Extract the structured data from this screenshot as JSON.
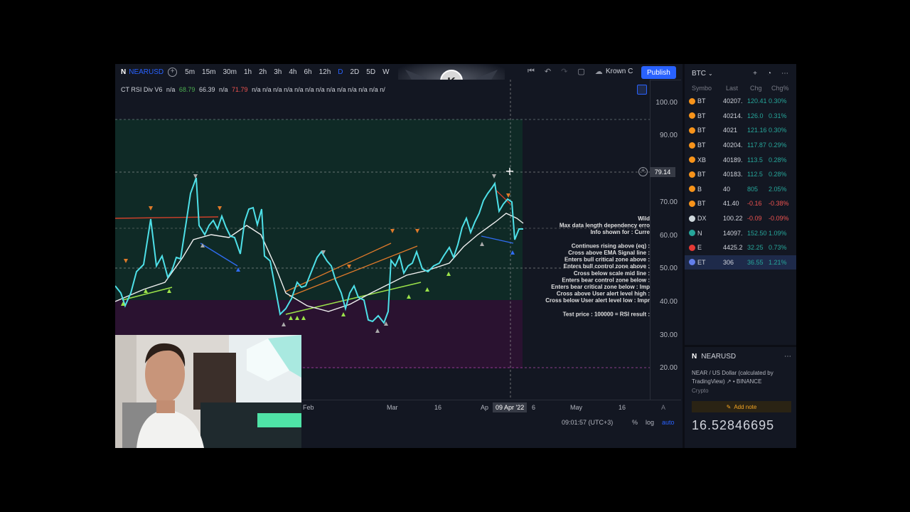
{
  "toolbar": {
    "symbol": "NEARUSD",
    "symbol_logo": "N",
    "intervals": [
      "5m",
      "15m",
      "30m",
      "1h",
      "2h",
      "3h",
      "4h",
      "6h",
      "12h",
      "D",
      "2D",
      "5D",
      "W"
    ],
    "active_interval": "D",
    "layout_name": "Krown C",
    "publish_label": "Publish"
  },
  "indicator": {
    "name": "CT RSI Div V6",
    "values": [
      "n/a",
      "68.79",
      "66.39",
      "n/a",
      "71.79",
      "n/a n/a n/a n/a n/a n/a n/a n/a n/a n/a n/a n/a n/"
    ]
  },
  "price_scale": {
    "ticks": [
      "100.00",
      "90.00",
      "79.14",
      "70.00",
      "60.00",
      "50.00",
      "40.00",
      "30.00",
      "20.00"
    ],
    "crosshair_value": "79.14"
  },
  "time_axis": {
    "ticks": [
      "Feb",
      "Mar",
      "16",
      "Ap",
      "6",
      "May",
      "16"
    ],
    "crosshair_date": "09 Apr '22"
  },
  "status": {
    "clock": "09:01:57 (UTC+3)",
    "percent": "%",
    "log": "log",
    "auto": "auto"
  },
  "annotation_lines": [
    "Wild",
    "Max data length dependency erro",
    "Info shown for : Curre",
    "",
    "Continues rising above (eq) :",
    "Cross above EMA Signal line :",
    "Enters bull critical zone above :",
    "Enters bull control zone above :",
    "Cross below scale mid line :",
    "Enters bear control zone below :",
    "Enters bear critical zone below : Imp",
    "Cross above  User alert level high :",
    "Cross below  User alert level low : Impr",
    "",
    "Test price : 100000 = RSI result :"
  ],
  "watchlist": {
    "name": "BTC",
    "columns": [
      "Symbo",
      "Last",
      "Chg",
      "Chg%"
    ],
    "rows": [
      {
        "sym": "BT",
        "last": "40207.",
        "chg": "120.41",
        "pct": "0.30%",
        "dir": "pos",
        "icon": "#f7931a"
      },
      {
        "sym": "BT",
        "last": "40214.",
        "chg": "126.0",
        "pct": "0.31%",
        "dir": "pos",
        "icon": "#f7931a"
      },
      {
        "sym": "BT",
        "last": "4021",
        "chg": "121.16",
        "pct": "0.30%",
        "dir": "pos",
        "icon": "#f7931a"
      },
      {
        "sym": "BT",
        "last": "40204.",
        "chg": "117.87",
        "pct": "0.29%",
        "dir": "pos",
        "icon": "#f7931a"
      },
      {
        "sym": "XB",
        "last": "40189.",
        "chg": "113.5",
        "pct": "0.28%",
        "dir": "pos",
        "icon": "#f7931a"
      },
      {
        "sym": "BT",
        "last": "40183.",
        "chg": "112.5",
        "pct": "0.28%",
        "dir": "pos",
        "icon": "#f7931a"
      },
      {
        "sym": "B",
        "last": "40",
        "chg": "805",
        "pct": "2.05%",
        "dir": "pos",
        "icon": "#f7931a"
      },
      {
        "sym": "BT",
        "last": "41.40",
        "chg": "-0.16",
        "pct": "-0.38%",
        "dir": "neg",
        "icon": "#f7931a"
      },
      {
        "sym": "DX",
        "last": "100.22",
        "chg": "-0.09",
        "pct": "-0.09%",
        "dir": "neg",
        "icon": "#cfd8dc"
      },
      {
        "sym": "N",
        "last": "14097.",
        "chg": "152.50",
        "pct": "1.09%",
        "dir": "pos",
        "icon": "#26a69a"
      },
      {
        "sym": "E",
        "last": "4425.2",
        "chg": "32.25",
        "pct": "0.73%",
        "dir": "pos",
        "icon": "#e53935"
      },
      {
        "sym": "ET",
        "last": "306",
        "chg": "36.55",
        "pct": "1.21%",
        "dir": "pos",
        "icon": "#627eea"
      }
    ],
    "selected_index": 11
  },
  "details": {
    "symbol": "NEARUSD",
    "description": "NEAR / US Dollar (calculated by TradingView) ↗ • BINANCE",
    "type": "Crypto",
    "add_note": "Add note",
    "price": "16.52846695"
  },
  "colors": {
    "background": "#131722",
    "accent": "#2962ff",
    "rsi_line": "#4ee0e8",
    "signal_line": "#ffffff",
    "bull_zone": "#0f2a26",
    "bear_zone": "#2a1230"
  }
}
